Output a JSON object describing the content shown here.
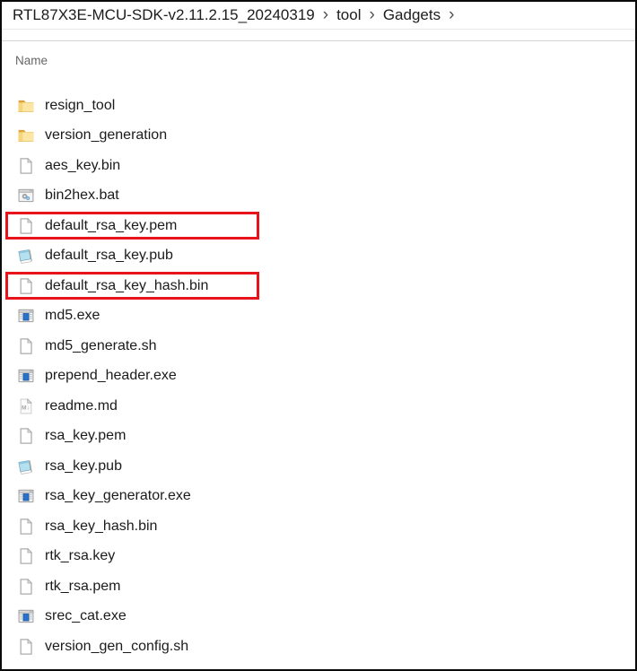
{
  "breadcrumb": {
    "separator": "›",
    "items": [
      {
        "label": "RTL87X3E-MCU-SDK-v2.11.2.15_20240319"
      },
      {
        "label": "tool"
      },
      {
        "label": "Gadgets"
      }
    ]
  },
  "column_header": {
    "name_label": "Name"
  },
  "files": [
    {
      "name": "resign_tool",
      "icon": "folder-icon",
      "highlighted": false
    },
    {
      "name": "version_generation",
      "icon": "folder-icon",
      "highlighted": false
    },
    {
      "name": "aes_key.bin",
      "icon": "file-icon",
      "highlighted": false
    },
    {
      "name": "bin2hex.bat",
      "icon": "batch-file-icon",
      "highlighted": false
    },
    {
      "name": "default_rsa_key.pem",
      "icon": "file-icon",
      "highlighted": true
    },
    {
      "name": "default_rsa_key.pub",
      "icon": "notepad-icon",
      "highlighted": false
    },
    {
      "name": "default_rsa_key_hash.bin",
      "icon": "file-icon",
      "highlighted": true
    },
    {
      "name": "md5.exe",
      "icon": "exe-icon",
      "highlighted": false
    },
    {
      "name": "md5_generate.sh",
      "icon": "file-icon",
      "highlighted": false
    },
    {
      "name": "prepend_header.exe",
      "icon": "exe-icon",
      "highlighted": false
    },
    {
      "name": "readme.md",
      "icon": "markdown-icon",
      "highlighted": false
    },
    {
      "name": "rsa_key.pem",
      "icon": "file-icon",
      "highlighted": false
    },
    {
      "name": "rsa_key.pub",
      "icon": "notepad-icon",
      "highlighted": false
    },
    {
      "name": "rsa_key_generator.exe",
      "icon": "exe-icon",
      "highlighted": false
    },
    {
      "name": "rsa_key_hash.bin",
      "icon": "file-icon",
      "highlighted": false
    },
    {
      "name": "rtk_rsa.key",
      "icon": "file-icon",
      "highlighted": false
    },
    {
      "name": "rtk_rsa.pem",
      "icon": "file-icon",
      "highlighted": false
    },
    {
      "name": "srec_cat.exe",
      "icon": "exe-icon",
      "highlighted": false
    },
    {
      "name": "version_gen_config.sh",
      "icon": "file-icon",
      "highlighted": false
    }
  ],
  "colors": {
    "highlight_border": "#e8141c",
    "folder_yellow": "#f6d57d",
    "exe_accent": "#2b71c7",
    "notepad_cyan": "#b5e0ef"
  }
}
